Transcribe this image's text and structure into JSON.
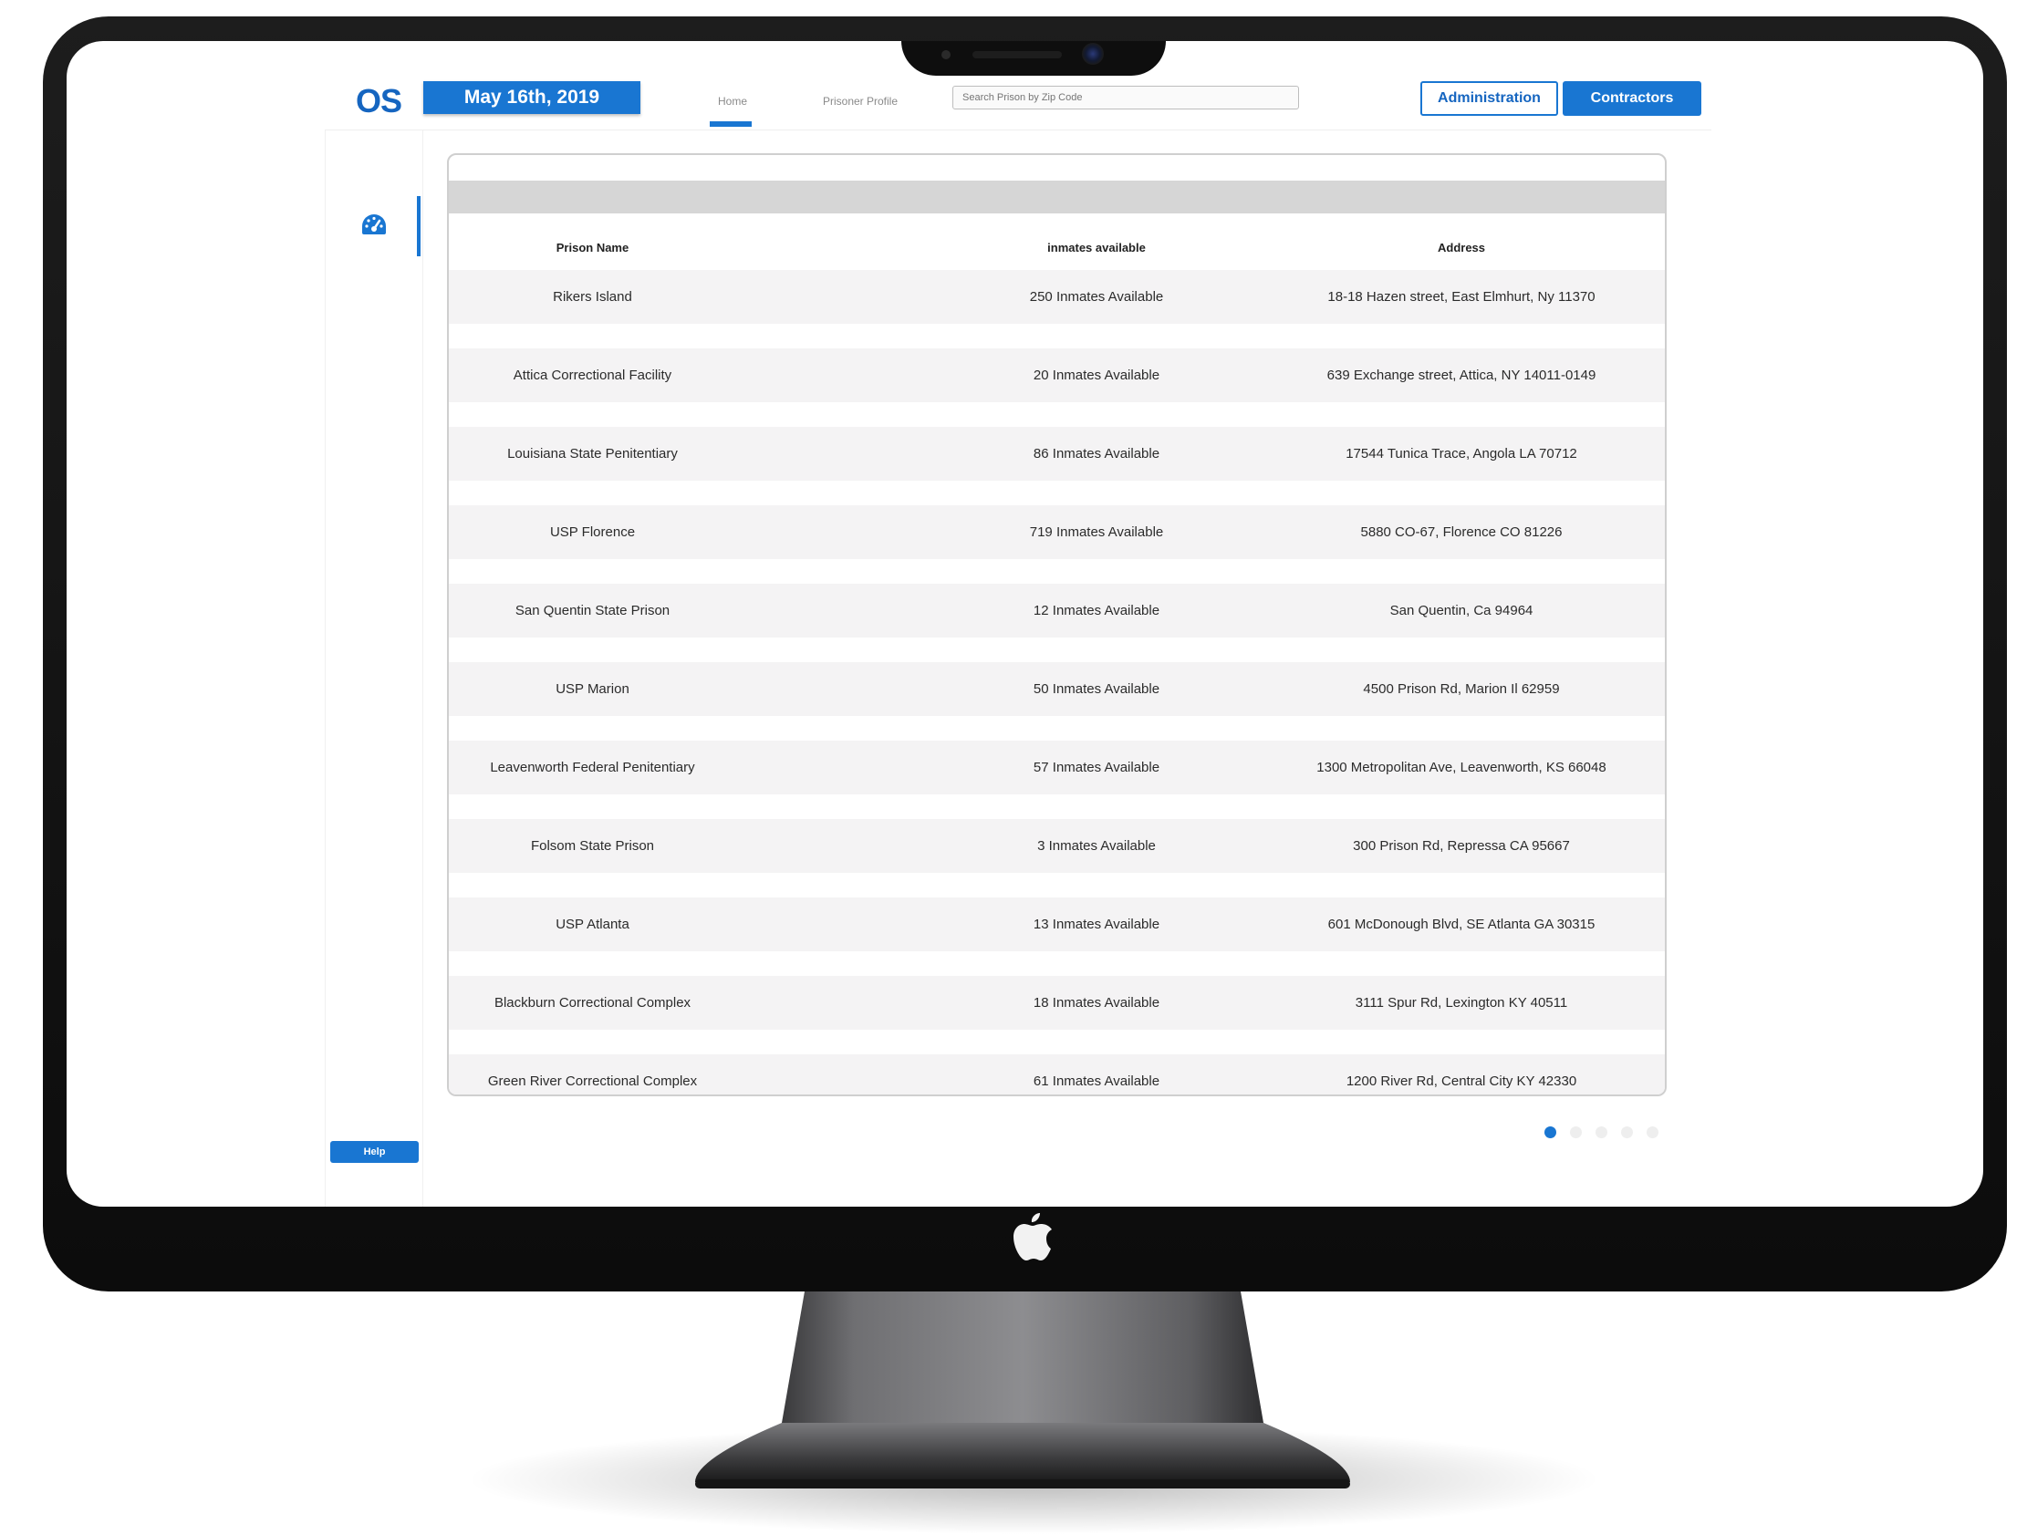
{
  "header": {
    "logo_text": "OS",
    "date_label": "May 16th, 2019",
    "nav_tabs": [
      {
        "label": "Home",
        "active": true
      },
      {
        "label": "Prisoner Profile",
        "active": false
      }
    ],
    "search_placeholder": "Search Prison by Zip Code",
    "admin_button": "Administration",
    "contractors_button": "Contractors"
  },
  "sidebar": {
    "active_icon": "dashboard-gauge-icon",
    "help_button": "Help"
  },
  "table": {
    "columns": [
      "Prison Name",
      "inmates available",
      "Address"
    ],
    "rows": [
      {
        "name": "Rikers Island",
        "inmates": "250 Inmates Available",
        "address": "18-18 Hazen street, East Elmhurt, Ny 11370"
      },
      {
        "name": "Attica Correctional Facility",
        "inmates": "20 Inmates Available",
        "address": "639 Exchange street, Attica, NY 14011-0149"
      },
      {
        "name": "Louisiana State Penitentiary",
        "inmates": "86 Inmates Available",
        "address": "17544 Tunica Trace, Angola LA 70712"
      },
      {
        "name": "USP Florence",
        "inmates": "719 Inmates Available",
        "address": "5880 CO-67, Florence CO 81226"
      },
      {
        "name": "San Quentin State Prison",
        "inmates": "12 Inmates Available",
        "address": "San Quentin, Ca 94964"
      },
      {
        "name": "USP Marion",
        "inmates": "50 Inmates Available",
        "address": "4500 Prison Rd, Marion Il 62959"
      },
      {
        "name": "Leavenworth Federal Penitentiary",
        "inmates": "57 Inmates Available",
        "address": "1300 Metropolitan Ave, Leavenworth, KS 66048"
      },
      {
        "name": "Folsom State Prison",
        "inmates": "3 Inmates Available",
        "address": "300 Prison Rd, Repressa CA 95667"
      },
      {
        "name": "USP Atlanta",
        "inmates": "13 Inmates Available",
        "address": "601 McDonough Blvd, SE Atlanta GA 30315"
      },
      {
        "name": "Blackburn Correctional Complex",
        "inmates": "18 Inmates Available",
        "address": "3111 Spur Rd, Lexington KY 40511"
      },
      {
        "name": "Green River Correctional Complex",
        "inmates": "61 Inmates Available",
        "address": "1200 River Rd, Central City KY 42330"
      }
    ]
  },
  "pagination": {
    "total_pages": 5,
    "current_page": 1
  },
  "colors": {
    "accent": "#1976d2",
    "row_background": "#f4f3f4",
    "band": "#d6d6d6"
  }
}
